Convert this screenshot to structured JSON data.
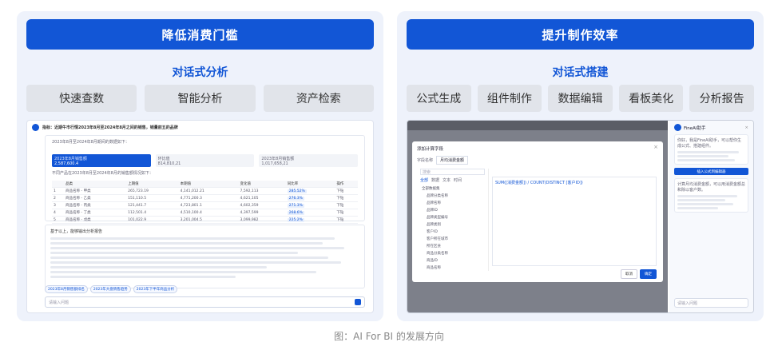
{
  "left": {
    "banner": "降低消费门槛",
    "subhead": "对话式分析",
    "pills": [
      "快速查数",
      "智能分析",
      "资产检索"
    ],
    "mock": {
      "question": "指标：近期牛市行情2023年8月至2024年8月之间的销售，销量前五的品牌",
      "answer_intro": "2023年8月至2024年8月期间的数据如下：",
      "kpis": [
        {
          "label": "2023年8月销售额",
          "value": "2,587,600.4"
        },
        {
          "label": "环比值",
          "value": "814,810,21"
        },
        {
          "label": "2023年8月销售额",
          "value": "1,017,658,21"
        }
      ],
      "table_title": "不同产品在2023年8月至2024年8月的销售额情况如下：",
      "table_headers": [
        "",
        "品类",
        "上期值",
        "本期值",
        "变化值",
        "同比率",
        "操作"
      ],
      "table_rows": [
        [
          "1",
          "商品名称 - 甲类",
          "265,723.19",
          "4,141,012.21",
          "7,592,113",
          "285.52%",
          "下钻"
        ],
        [
          "2",
          "商品名称 - 乙类",
          "151,110.5",
          "4,771,200.3",
          "4,621,105",
          "276.3%",
          "下钻"
        ],
        [
          "3",
          "商品名称 - 丙类",
          "121,441.7",
          "4,723,801.1",
          "4,602,359",
          "271.3%",
          "下钻"
        ],
        [
          "4",
          "商品名称 - 丁类",
          "112,501.4",
          "4,510,100.4",
          "4,397,599",
          "268.6%",
          "下钻"
        ],
        [
          "5",
          "商品名称 - 戊类",
          "101,022.9",
          "3,201,004.5",
          "3,099,982",
          "225.2%",
          "下钻"
        ]
      ],
      "analysis_title": "基于以上，能够输出分析报告",
      "suggestions": [
        "2023年8月销售额排名",
        "2023年大盘销售趋势",
        "2023年下半年商品分析"
      ],
      "input_placeholder": "请输入问题"
    }
  },
  "right": {
    "banner": "提升制作效率",
    "subhead": "对话式搭建",
    "pills": [
      "公式生成",
      "组件制作",
      "数据编辑",
      "看板美化",
      "分析报告"
    ],
    "mock": {
      "dialog_title": "添加计算字段",
      "field_name_label": "字段名称",
      "field_name_value": "月均消费金额",
      "search_placeholder": "搜索",
      "tree_tabs": [
        "全部",
        "数据",
        "文本",
        "时间"
      ],
      "tree_items": [
        "全部数据集",
        "品牌分类名称",
        "品牌名称",
        "品牌ID",
        "品牌类型编号",
        "品牌类别",
        "客户ID",
        "客户所在城市",
        "所在区县",
        "商品分类名称",
        "商品ID",
        "商品名称"
      ],
      "formula": "SUM([消费金额]) / COUNT(DISTINCT [客户ID])",
      "cancel": "取消",
      "confirm": "确定",
      "assistant_title": "FineAI助手",
      "assistant_greeting": "你好，我是FineAI助手，可以帮你生成公式、搭建组件。",
      "assistant_reply": "计算月均消费金额，可以用消费金额总和除以客户数。",
      "apply_button": "插入公式到编辑器",
      "input_placeholder": "请输入问题"
    }
  },
  "caption": "图：AI For BI 的发展方向"
}
